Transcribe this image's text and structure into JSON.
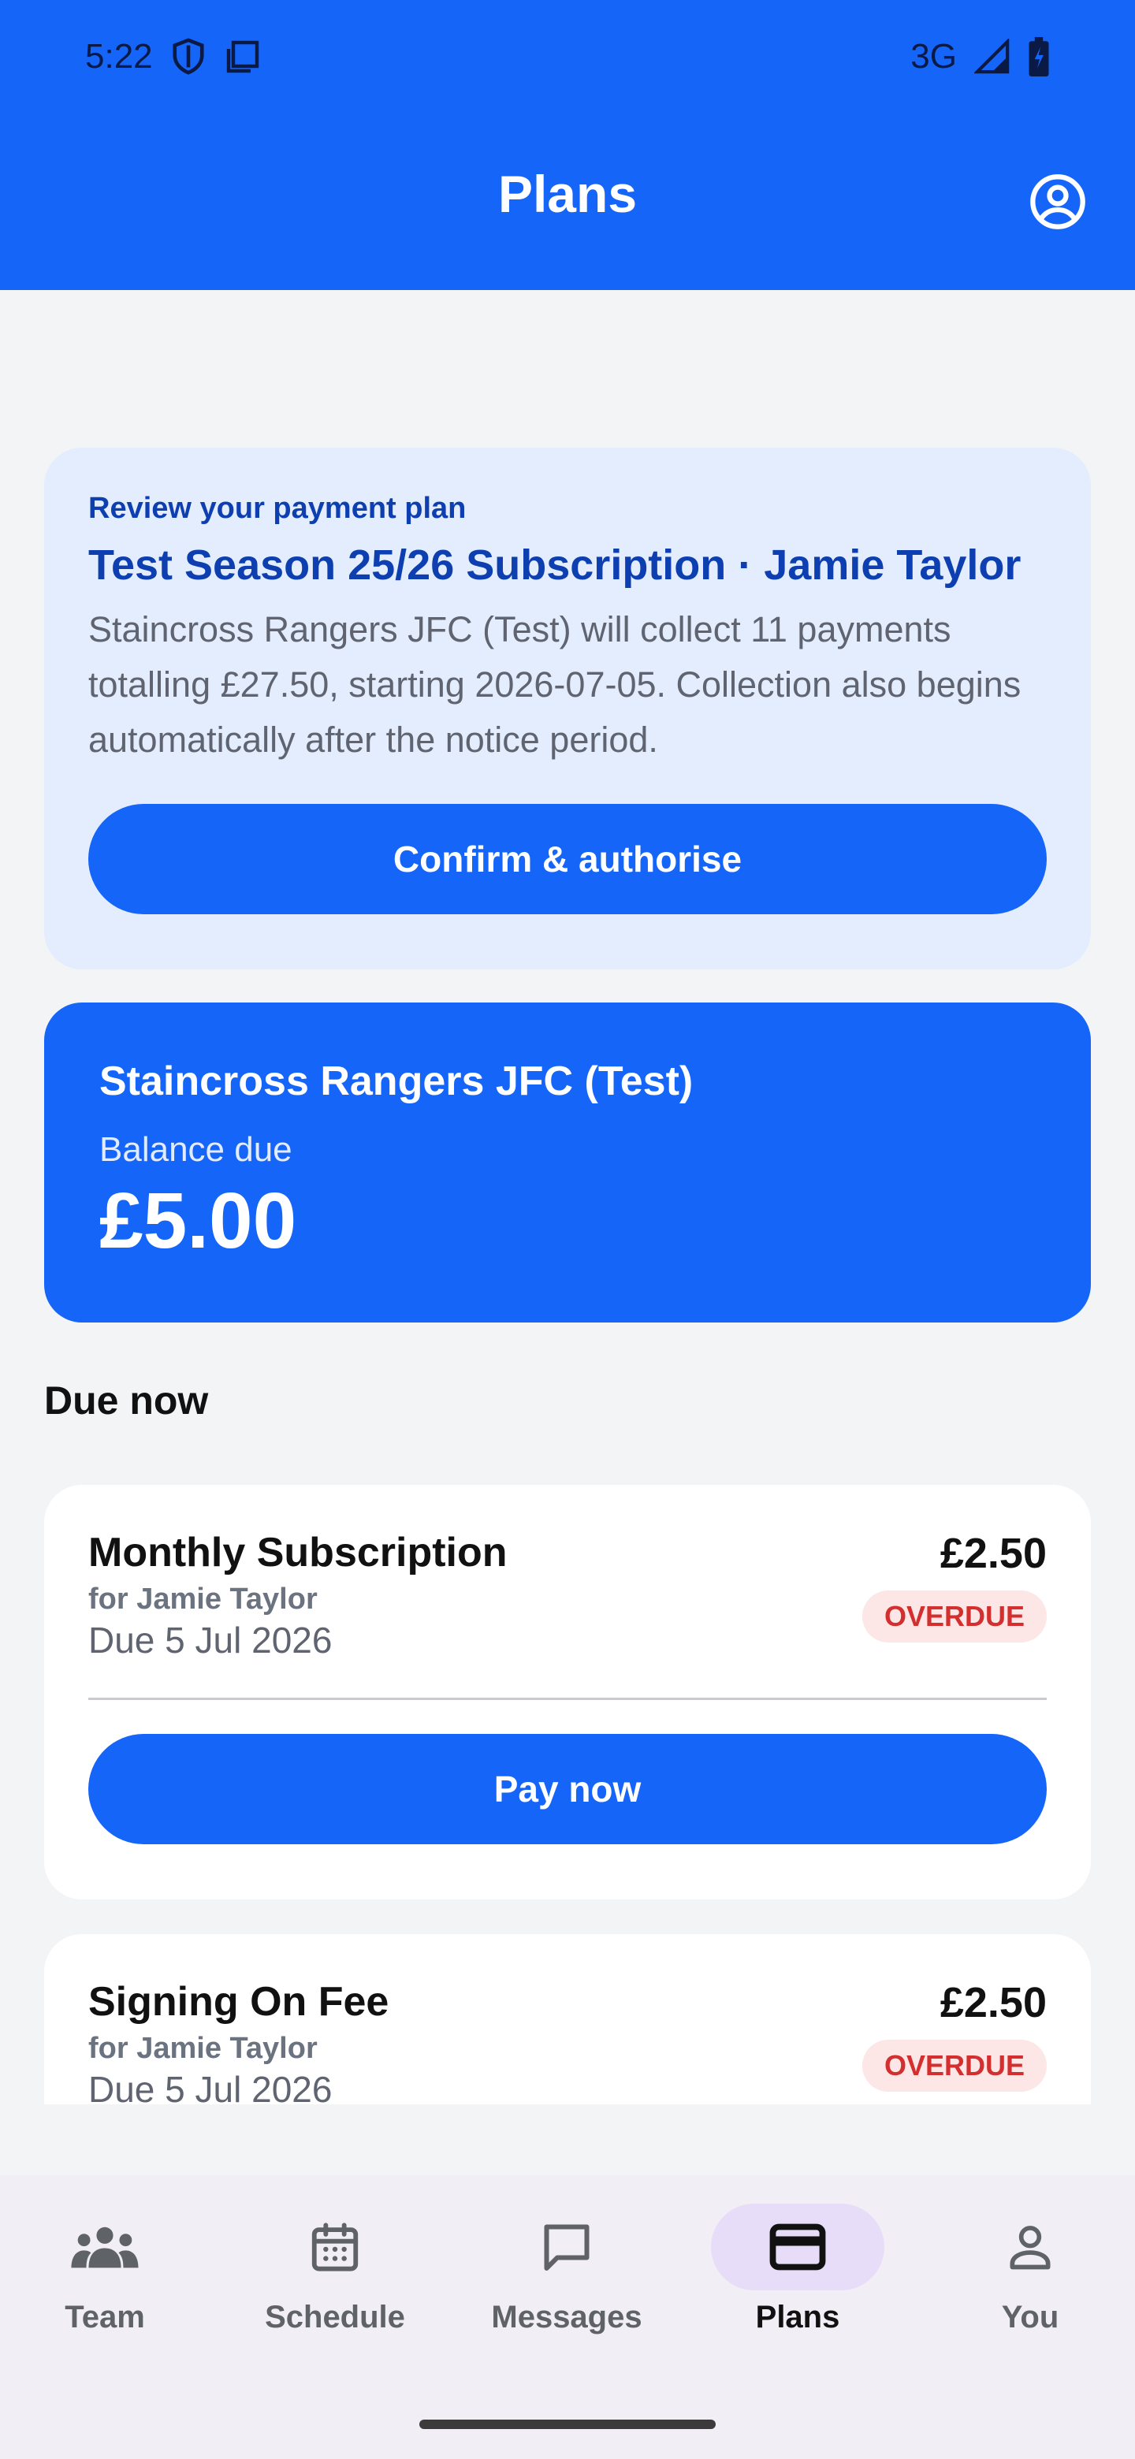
{
  "status_bar": {
    "time": "5:22",
    "network": "3G"
  },
  "header": {
    "title": "Plans"
  },
  "review": {
    "kicker": "Review your payment plan",
    "title": "Test Season 25/26 Subscription · Jamie Taylor",
    "body": "Staincross Rangers JFC (Test) will collect 11 payments totalling £27.50, starting 2026-07-05. Collection also begins automatically after the notice period.",
    "button": "Confirm & authorise"
  },
  "balance": {
    "club": "Staincross Rangers JFC (Test)",
    "label": "Balance due",
    "amount": "£5.00"
  },
  "due_now": {
    "heading": "Due now",
    "items": [
      {
        "name": "Monthly Subscription",
        "for": "for Jamie Taylor",
        "due": "Due 5 Jul 2026",
        "amount": "£2.50",
        "status": "OVERDUE",
        "button": "Pay now"
      },
      {
        "name": "Signing On Fee",
        "for": "for Jamie Taylor",
        "due": "Due 5 Jul 2026",
        "amount": "£2.50",
        "status": "OVERDUE"
      }
    ]
  },
  "nav": {
    "items": [
      {
        "label": "Team",
        "icon": "team-icon"
      },
      {
        "label": "Schedule",
        "icon": "calendar-icon"
      },
      {
        "label": "Messages",
        "icon": "message-icon"
      },
      {
        "label": "Plans",
        "icon": "card-icon",
        "active": true
      },
      {
        "label": "You",
        "icon": "person-icon"
      }
    ]
  },
  "colors": {
    "primary": "#1565F8",
    "overdue": "#D32F2F",
    "card_tint": "#E3EDFD"
  }
}
